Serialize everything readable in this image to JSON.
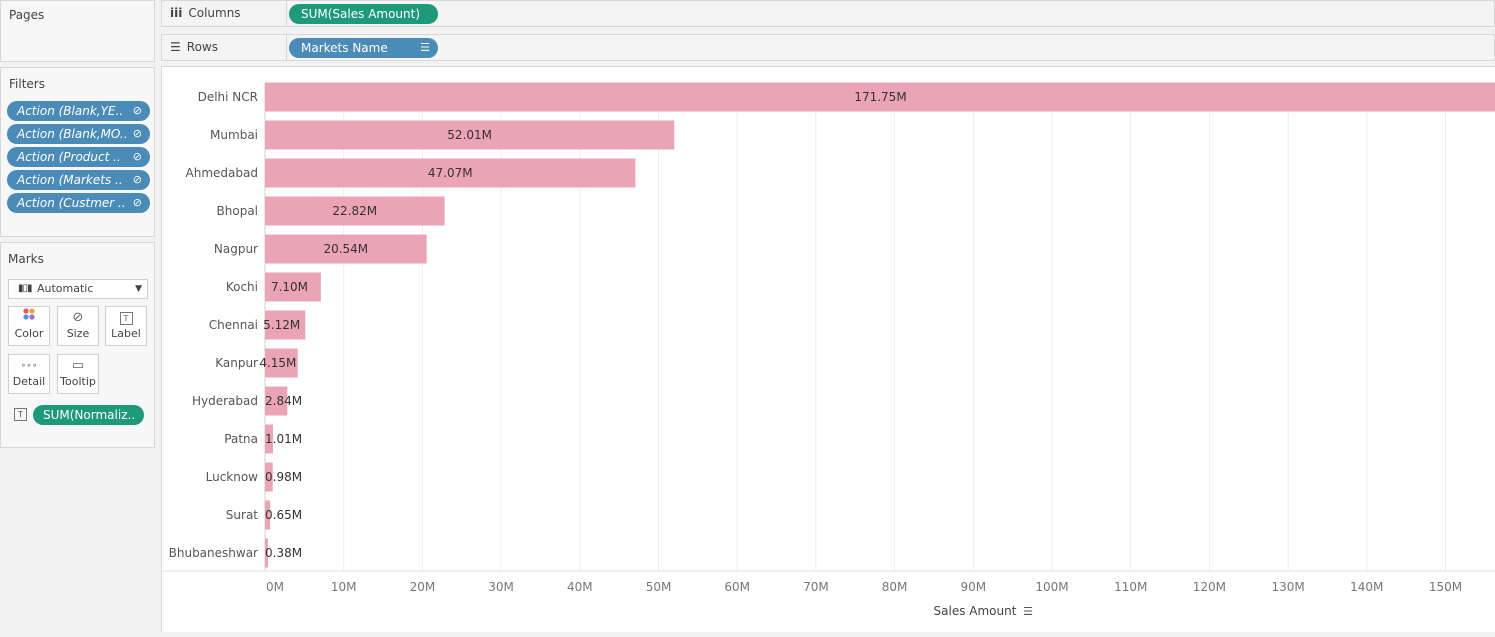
{
  "pages_panel": {
    "title": "Pages"
  },
  "columns_shelf": {
    "label": "Columns",
    "pill": "SUM(Sales Amount)"
  },
  "rows_shelf": {
    "label": "Rows",
    "pill": "Markets Name"
  },
  "filters_panel": {
    "title": "Filters",
    "items": [
      "Action (Blank,YE..",
      "Action (Blank,MO..",
      "Action (Product ..",
      "Action (Markets ..",
      "Action (Custmer .."
    ]
  },
  "marks_panel": {
    "title": "Marks",
    "mark_type": "Automatic",
    "cards": {
      "color": "Color",
      "size": "Size",
      "label": "Label",
      "detail": "Detail",
      "tooltip": "Tooltip"
    },
    "label_pill": "SUM(Normaliz.."
  },
  "colors": {
    "bar": "#eba4b6",
    "green_pill": "#1e9a7a",
    "blue_pill": "#4a8bb8"
  },
  "chart_data": {
    "type": "bar",
    "orientation": "horizontal",
    "categories": [
      "Delhi NCR",
      "Mumbai",
      "Ahmedabad",
      "Bhopal",
      "Nagpur",
      "Kochi",
      "Chennai",
      "Kanpur",
      "Hyderabad",
      "Patna",
      "Lucknow",
      "Surat",
      "Bhubaneshwar"
    ],
    "values": [
      171.75,
      52.01,
      47.07,
      22.82,
      20.54,
      7.1,
      5.12,
      4.15,
      2.84,
      1.01,
      0.98,
      0.65,
      0.38
    ],
    "value_labels": [
      "171.75M",
      "52.01M",
      "47.07M",
      "22.82M",
      "20.54M",
      "7.10M",
      "5.12M",
      "4.15M",
      "2.84M",
      "1.01M",
      "0.98M",
      "0.65M",
      "0.38M"
    ],
    "x_ticks": [
      "0M",
      "10M",
      "20M",
      "30M",
      "40M",
      "50M",
      "60M",
      "70M",
      "80M",
      "90M",
      "100M",
      "110M",
      "120M",
      "130M",
      "140M",
      "150M"
    ],
    "xlim": [
      0,
      156
    ],
    "xlabel": "Sales Amount",
    "grid": "vertical"
  }
}
